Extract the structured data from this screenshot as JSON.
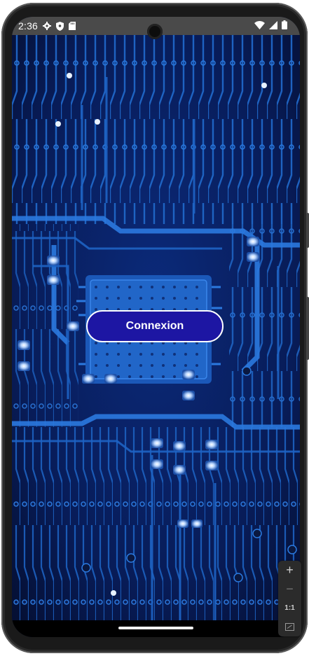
{
  "status_bar": {
    "time": "2:36",
    "left_icons": [
      "gear-icon",
      "shield-icon",
      "sd-card-icon"
    ],
    "right_icons": [
      "wifi-icon",
      "signal-icon",
      "battery-icon"
    ]
  },
  "main": {
    "background": "circuit-board-image",
    "login_button_label": "Connexion"
  },
  "zoom_controls": {
    "zoom_in": "+",
    "zoom_out": "−",
    "actual_size": "1:1",
    "fit_icon": "fit-screen-icon"
  },
  "colors": {
    "button_fill": "#1d16a3",
    "button_border": "#ffffff",
    "status_bar": "#4a4a4a",
    "circuit_dark": "#06123f",
    "circuit_trace": "#1f68c9"
  }
}
